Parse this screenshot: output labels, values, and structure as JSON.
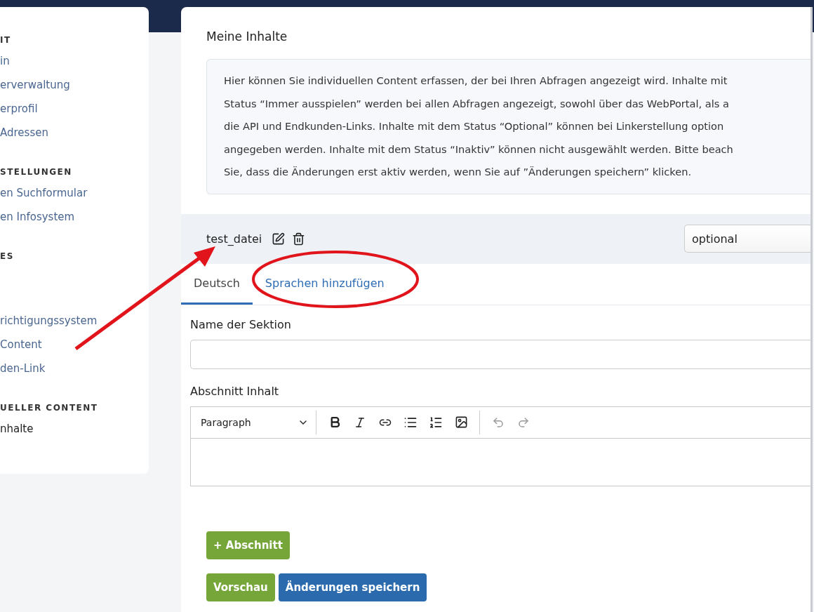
{
  "sidebar": {
    "groups": [
      {
        "heading": "IT",
        "items": [
          {
            "label": "in",
            "selected": false
          },
          {
            "label": "erverwaltung",
            "selected": false
          },
          {
            "label": "erprofil",
            "selected": false
          },
          {
            "label": "Adressen",
            "selected": false
          }
        ]
      },
      {
        "heading": "STELLUNGEN",
        "items": [
          {
            "label": "en Suchformular",
            "selected": false
          },
          {
            "label": "en Infosystem",
            "selected": false
          }
        ]
      },
      {
        "heading": "ES",
        "items": [
          {
            "label": "richtigungssystem",
            "selected": false
          },
          {
            "label": "Content",
            "selected": false
          },
          {
            "label": "den-Link",
            "selected": false
          }
        ]
      },
      {
        "heading": "UELLER CONTENT",
        "items": [
          {
            "label": "nhalte",
            "selected": true
          }
        ]
      }
    ]
  },
  "main": {
    "title": "Meine Inhalte",
    "info_lines": [
      "Hier können Sie individuellen Content erfassen, der bei Ihren Abfragen angezeigt wird. Inhalte mit",
      "Status “Immer ausspielen” werden bei allen Abfragen angezeigt, sowohl über das WebPortal, als a",
      "die API und Endkunden-Links. Inhalte mit dem Status “Optional” können bei Linkerstellung option",
      "angegeben werden. Inhalte mit dem Status “Inaktiv” können nicht ausgewählt werden. Bitte beach",
      "Sie, dass die Änderungen erst aktiv werden, wenn Sie auf ”Änderungen speichern” klicken."
    ],
    "section": {
      "name": "test_datei",
      "status": "optional"
    },
    "tabs": [
      {
        "label": "Deutsch",
        "selected": true
      },
      {
        "label": "Sprachen hinzufügen",
        "selected": false
      }
    ],
    "fields": [
      {
        "kind": "input",
        "label": "Name der Sektion"
      },
      {
        "kind": "editor",
        "label": "Abschnitt Inhalt",
        "block_format": "Paragraph"
      }
    ],
    "add_button": "+ Abschnitt",
    "buttons": [
      {
        "label": "Vorschau",
        "kind": "secondary"
      },
      {
        "label": "Änderungen speichern",
        "kind": "primary"
      }
    ]
  }
}
